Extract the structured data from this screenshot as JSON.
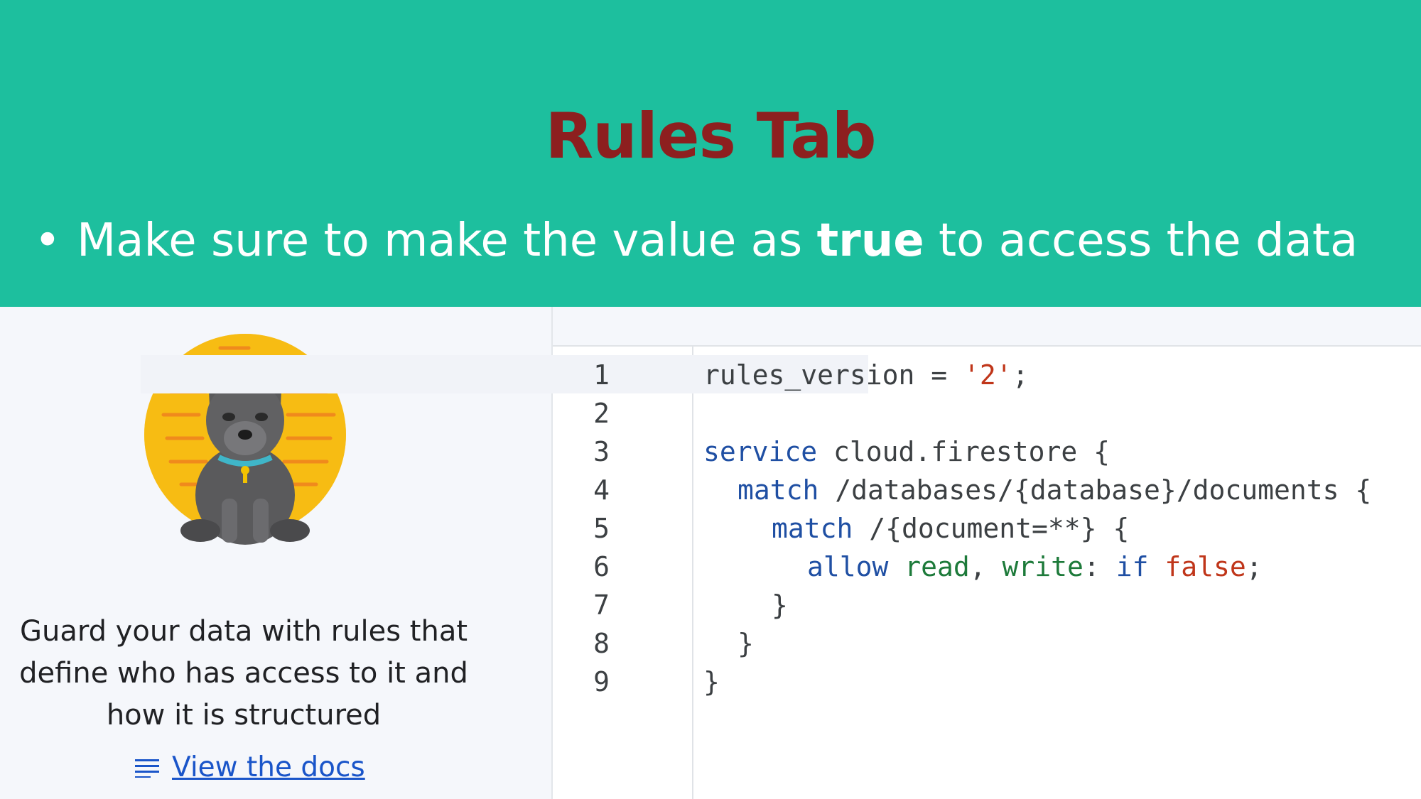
{
  "slide": {
    "title": "Rules Tab",
    "bullet": {
      "before": "Make sure to make the value as ",
      "bold": "true",
      "after": " to access the data"
    }
  },
  "left_panel": {
    "description_lines": [
      "Guard your data with rules that",
      "define who has access to it and",
      "how it is structured"
    ],
    "docs_link_label": "View the docs",
    "docs_icon": "docs-lines-icon",
    "illustration": "guard-dog-illustration"
  },
  "editor": {
    "line_numbers": [
      "1",
      "2",
      "3",
      "4",
      "5",
      "6",
      "7",
      "8",
      "9"
    ],
    "lines": {
      "l1_a": "rules_version = ",
      "l1_str": "'2'",
      "l1_b": ";",
      "l3_kw": "service",
      "l3_b": " cloud.firestore {",
      "l4_kw": "match",
      "l4_b": " /databases/{database}/documents {",
      "l5_kw": "match",
      "l5_b": " /{document=**} {",
      "l6_kw": "allow",
      "l6_read": " read",
      "l6_comma": ",",
      "l6_write": " write",
      "l6_colon": ": ",
      "l6_if": "if",
      "l6_false": " false",
      "l6_semi": ";",
      "l7": "}",
      "l8": "}",
      "l9": "}"
    }
  },
  "colors": {
    "header_bg": "#1dbf9e",
    "title": "#8d1f1f",
    "keyword": "#1f4fa3",
    "function": "#1d7a3a",
    "string": "#c0361a",
    "link": "#1a55c9"
  }
}
